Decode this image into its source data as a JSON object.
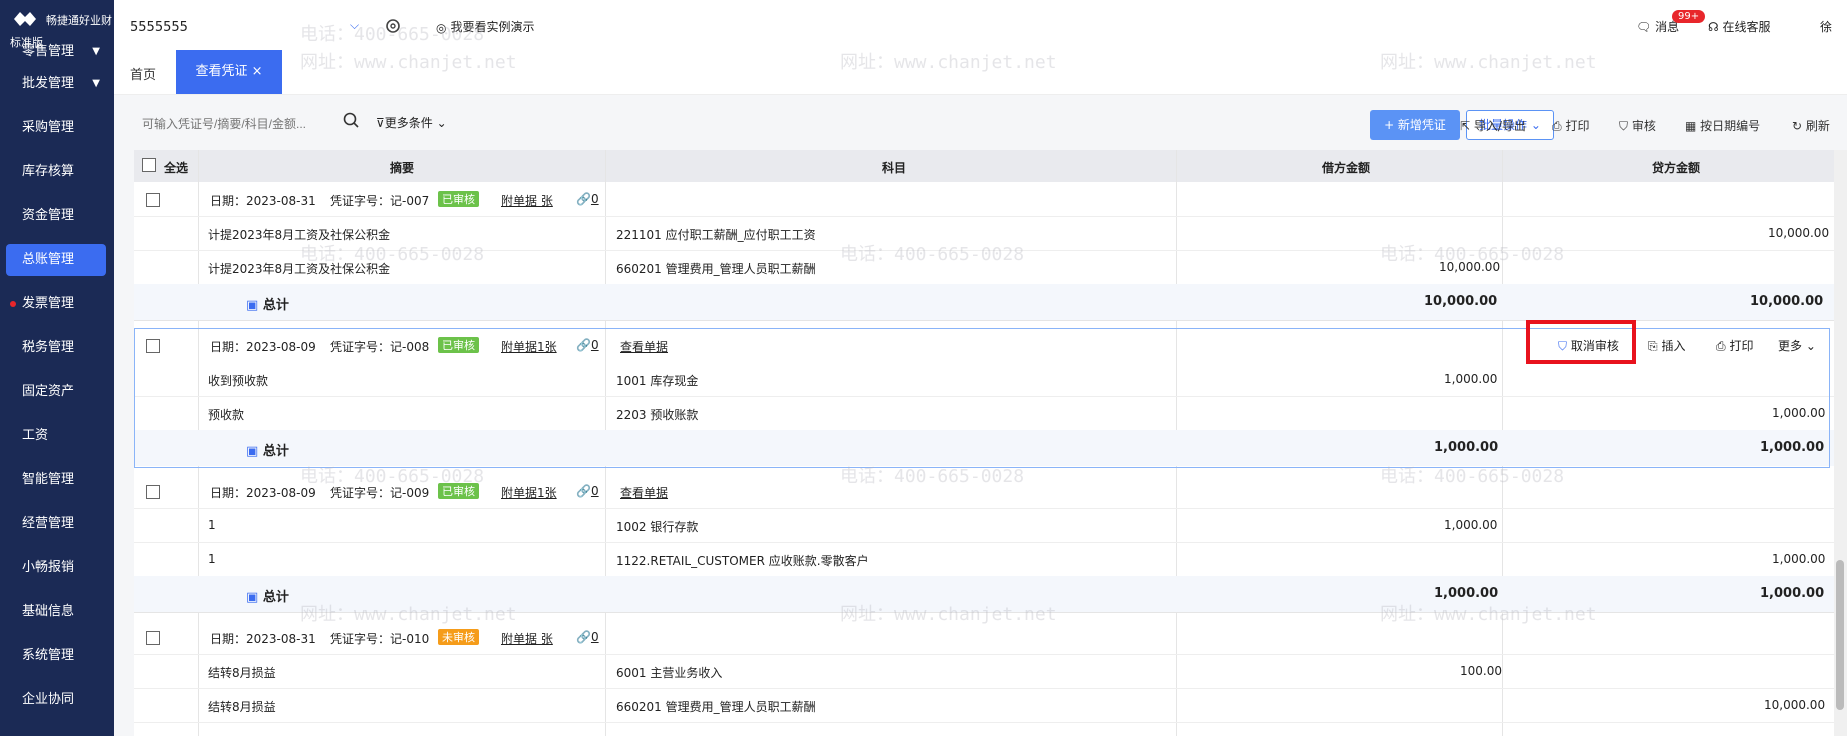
{
  "sidebar": {
    "brand": "畅捷通好业财",
    "edition": "标准版",
    "items": [
      {
        "label": "零售管理",
        "caret": "▼"
      },
      {
        "label": "批发管理",
        "caret": "▼"
      },
      {
        "label": "采购管理"
      },
      {
        "label": "库存核算"
      },
      {
        "label": "资金管理"
      },
      {
        "label": "总账管理"
      },
      {
        "label": "发票管理"
      },
      {
        "label": "税务管理"
      },
      {
        "label": "固定资产"
      },
      {
        "label": "工资"
      },
      {
        "label": "智能管理"
      },
      {
        "label": "经营管理"
      },
      {
        "label": "小畅报销"
      },
      {
        "label": "基础信息"
      },
      {
        "label": "系统管理"
      },
      {
        "label": "企业协同"
      }
    ]
  },
  "header": {
    "company": "5555555",
    "demo": "我要看实例演示",
    "msg": "消息",
    "badge": "99+",
    "service": "在线客服",
    "user": "徐"
  },
  "tabs": {
    "home": "首页",
    "active": "查看凭证",
    "close": "×"
  },
  "toolbar": {
    "search_placeholder": "可输入凭证号/摘要/科目/金额...",
    "more": "更多条件",
    "new": "+ 新增凭证",
    "batch": "批量操作",
    "import": "导入/导出",
    "print": "打印",
    "audit": "审核",
    "renumber": "按日期编号",
    "refresh": "刷新"
  },
  "grid": {
    "headers": {
      "select_all": "全选",
      "summary": "摘要",
      "account": "科目",
      "debit": "借方金额",
      "credit": "贷方金额"
    },
    "vouchers": [
      {
        "date": "日期：2023-08-31",
        "no": "凭证字号：记-007",
        "status": "已审核",
        "attach": "附单据 张",
        "links": "0",
        "view": "",
        "lines": [
          {
            "summary": "计提2023年8月工资及社保公积金",
            "account": "221101 应付职工薪酬_应付职工工资",
            "debit": "",
            "credit": "10,000.00"
          },
          {
            "summary": "计提2023年8月工资及社保公积金",
            "account": "660201 管理费用_管理人员职工薪酬",
            "debit": "10,000.00",
            "credit": ""
          }
        ],
        "total_label": "总计",
        "total_debit": "10,000.00",
        "total_credit": "10,000.00"
      },
      {
        "date": "日期：2023-08-09",
        "no": "凭证字号：记-008",
        "status": "已审核",
        "attach": "附单据1张",
        "links": "0",
        "view": "查看单据",
        "lines": [
          {
            "summary": "收到预收款",
            "account": "1001 库存现金",
            "debit": "1,000.00",
            "credit": ""
          },
          {
            "summary": "预收款",
            "account": "2203 预收账款",
            "debit": "",
            "credit": "1,000.00"
          }
        ],
        "total_label": "总计",
        "total_debit": "1,000.00",
        "total_credit": "1,000.00",
        "actions": {
          "cancel": "取消审核",
          "insert": "插入",
          "print": "打印",
          "more": "更多"
        }
      },
      {
        "date": "日期：2023-08-09",
        "no": "凭证字号：记-009",
        "status": "已审核",
        "attach": "附单据1张",
        "links": "0",
        "view": "查看单据",
        "lines": [
          {
            "summary": "1",
            "account": "1002 银行存款",
            "debit": "1,000.00",
            "credit": ""
          },
          {
            "summary": "1",
            "account": "1122.RETAIL_CUSTOMER 应收账款.零散客户",
            "debit": "",
            "credit": "1,000.00"
          }
        ],
        "total_label": "总计",
        "total_debit": "1,000.00",
        "total_credit": "1,000.00"
      },
      {
        "date": "日期：2023-08-31",
        "no": "凭证字号：记-010",
        "status": "未审核",
        "attach": "附单据 张",
        "links": "0",
        "view": "",
        "lines": [
          {
            "summary": "结转8月损益",
            "account": "6001 主营业务收入",
            "debit": "100.00",
            "credit": ""
          },
          {
            "summary": "结转8月损益",
            "account": "660201 管理费用_管理人员职工薪酬",
            "debit": "",
            "credit": "10,000.00"
          }
        ]
      }
    ]
  },
  "watermark": {
    "phone": "电话：400-665-0028",
    "site": "网址：www.chanjet.net"
  },
  "colors": {
    "sidebar": "#1b2a55",
    "accent": "#3b6cf0",
    "ok": "#6cc24a",
    "pending": "#f59c1a",
    "highlight": "#e8121d"
  }
}
